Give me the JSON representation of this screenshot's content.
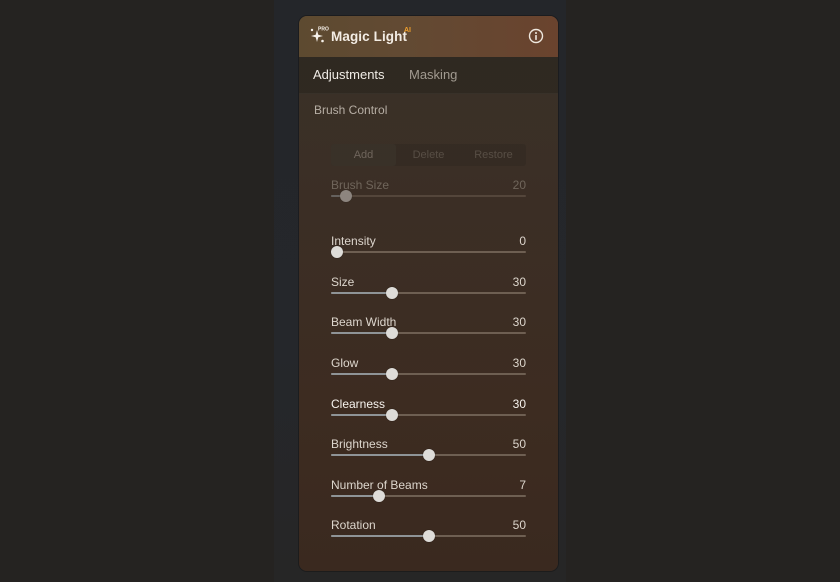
{
  "panel": {
    "title": "Magic Light",
    "title_badge": "AI",
    "logo_badge": "PRO",
    "icons": {
      "logo": "sparkles-pro-icon",
      "info": "info-icon"
    },
    "colors": {
      "accent_badge": "#f2a12c",
      "header_start": "#5d4a30",
      "header_end": "#6a432e"
    }
  },
  "tabs": [
    {
      "label": "Adjustments",
      "active": true
    },
    {
      "label": "Masking",
      "active": false
    }
  ],
  "brush_control": {
    "label": "Brush Control",
    "modes": [
      {
        "label": "Add",
        "selected": true
      },
      {
        "label": "Delete",
        "selected": false
      },
      {
        "label": "Restore",
        "selected": false
      }
    ],
    "brush_size": {
      "label": "Brush Size",
      "value": "20",
      "fraction": 0.05,
      "disabled": true
    }
  },
  "sliders": [
    {
      "label": "Intensity",
      "value": "0",
      "fraction": 0.0
    },
    {
      "label": "Size",
      "value": "30",
      "fraction": 0.3
    },
    {
      "label": "Beam Width",
      "value": "30",
      "fraction": 0.3
    },
    {
      "label": "Glow",
      "value": "30",
      "fraction": 0.3
    },
    {
      "label": "Clearness",
      "value": "30",
      "fraction": 0.3,
      "emphasized": true
    },
    {
      "label": "Brightness",
      "value": "50",
      "fraction": 0.5
    },
    {
      "label": "Number of Beams",
      "value": "7",
      "fraction": 0.23
    },
    {
      "label": "Rotation",
      "value": "50",
      "fraction": 0.5
    }
  ]
}
